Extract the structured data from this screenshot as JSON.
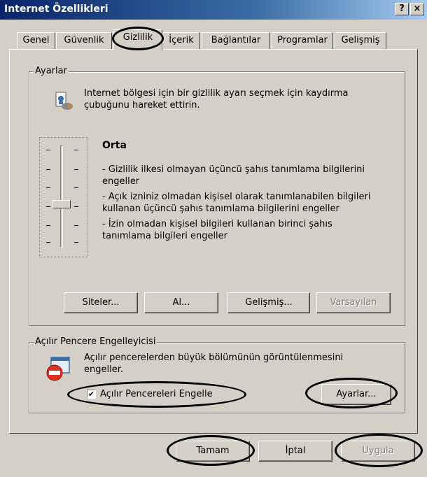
{
  "window": {
    "title": "Internet Özellikleri",
    "help_label": "?",
    "close_label": "×"
  },
  "tabs": [
    {
      "label": "Genel"
    },
    {
      "label": "Güvenlik"
    },
    {
      "label": "Gizlilik",
      "active": true
    },
    {
      "label": "İçerik"
    },
    {
      "label": "Bağlantılar"
    },
    {
      "label": "Programlar"
    },
    {
      "label": "Gelişmiş"
    }
  ],
  "settings": {
    "legend": "Ayarlar",
    "intro_line1": "Internet bölgesi için bir gizlilik ayarı seçmek için kaydırma",
    "intro_line2": "çubuğunu hareket ettirin.",
    "level_title": "Orta",
    "desc_lines": [
      "- Gizlilik ilkesi olmayan üçüncü şahıs tanımlama bilgilerini",
      "engeller",
      "- Açık izniniz olmadan kişisel olarak tanımlanabilen bilgileri",
      "kullanan üçüncü şahıs tanımlama bilgilerini engeller",
      "- İzin olmadan kişisel bilgileri kullanan birinci şahıs",
      "tanımlama bilgileri engeller"
    ],
    "buttons": {
      "sites": "Siteler...",
      "import": "Al...",
      "advanced": "Gelişmiş...",
      "default": "Varsayılan"
    }
  },
  "popup": {
    "legend": "Açılır Pencere Engelleyicisi",
    "desc_line1": "Açılır pencerelerden büyük bölümünün görüntülenmesini",
    "desc_line2": "engeller.",
    "checkbox_label": "Açılır Pencereleri Engelle",
    "checkbox_checked": true,
    "settings_button": "Ayarlar..."
  },
  "footer": {
    "ok": "Tamam",
    "cancel": "İptal",
    "apply": "Uygula"
  }
}
